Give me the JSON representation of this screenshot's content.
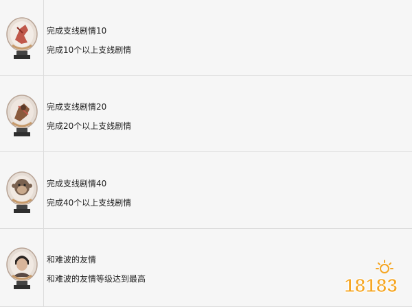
{
  "rows": [
    {
      "title": "完成支线剧情10",
      "desc": "完成10个以上支线剧情",
      "icon": "trophy-red-figure-icon",
      "accent": "#c0584a"
    },
    {
      "title": "完成支线剧情20",
      "desc": "完成20个以上支线剧情",
      "icon": "trophy-warrior-icon",
      "accent": "#8a5a3c"
    },
    {
      "title": "完成支线剧情40",
      "desc": "完成40个以上支线剧情",
      "icon": "trophy-monkey-icon",
      "accent": "#7a6250"
    },
    {
      "title": "和难波的友情",
      "desc": "和难波的友情等级达到最高",
      "icon": "trophy-portrait-icon",
      "accent": "#5a4a44"
    }
  ],
  "watermark": {
    "text": "18183",
    "icon": "sun-logo-icon",
    "color": "#f5a623"
  }
}
